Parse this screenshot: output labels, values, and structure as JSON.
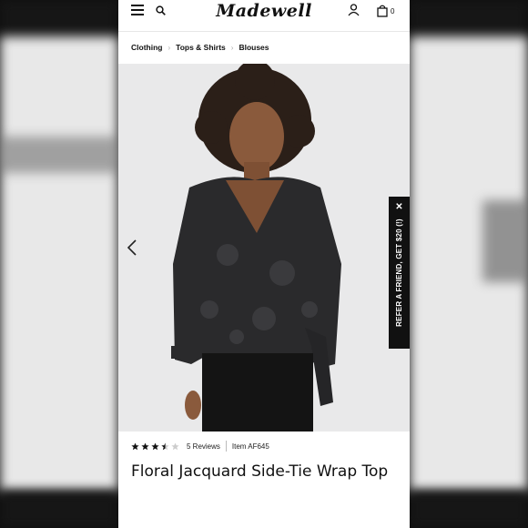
{
  "header": {
    "logo_text": "Madewell",
    "bag_count": "0"
  },
  "breadcrumb": {
    "items": [
      "Clothing",
      "Tops & Shirts",
      "Blouses"
    ]
  },
  "promo": {
    "text": "REFER A FRIEND, GET $20 (!)",
    "close": "✕"
  },
  "product": {
    "rating": 3.5,
    "reviews_label": "5 Reviews",
    "item_label": "Item AF645",
    "title": "Floral Jacquard Side-Tie Wrap Top"
  },
  "colors": {
    "accent": "#111111",
    "hero_bg": "#e9e9ea",
    "garment": "#2a2a2c"
  }
}
